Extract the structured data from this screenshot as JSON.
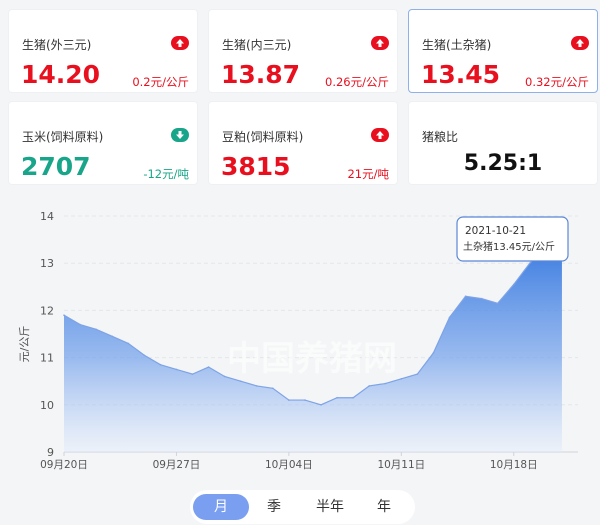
{
  "cards": [
    {
      "name": "生猪(外三元)",
      "value": "14.20",
      "change": "0.2元/公斤",
      "direction": "up"
    },
    {
      "name": "生猪(内三元)",
      "value": "13.87",
      "change": "0.26元/公斤",
      "direction": "up"
    },
    {
      "name": "生猪(土杂猪)",
      "value": "13.45",
      "change": "0.32元/公斤",
      "direction": "up"
    },
    {
      "name": "玉米(饲料原料)",
      "value": "2707",
      "change": "-12元/吨",
      "direction": "down"
    },
    {
      "name": "豆粕(饲料原料)",
      "value": "3815",
      "change": "21元/吨",
      "direction": "up"
    },
    {
      "name": "猪粮比",
      "value": "5.25:1"
    }
  ],
  "colors": {
    "up": "#e8101e",
    "down": "#18a589",
    "line": "#7ea3e6",
    "marker": "#2f7ae0"
  },
  "watermark": "中国养猪网",
  "tooltip": {
    "date": "2021-10-21",
    "text": "土杂猪13.45元/公斤"
  },
  "tabs": [
    "月",
    "季",
    "半年",
    "年"
  ],
  "active_tab": 0,
  "chart_data": {
    "type": "area",
    "ylabel": "元/公斤",
    "ylim": [
      9,
      14
    ],
    "yticks": [
      9,
      10,
      11,
      12,
      13,
      14
    ],
    "start_date": "2021-09-20",
    "xtick_labels": [
      {
        "day": 0,
        "label": "09月20日"
      },
      {
        "day": 7,
        "label": "09月27日"
      },
      {
        "day": 14,
        "label": "10月04日"
      },
      {
        "day": 21,
        "label": "10月11日"
      },
      {
        "day": 28,
        "label": "10月18日"
      }
    ],
    "series": [
      {
        "name": "土杂猪",
        "points": [
          {
            "date": "09-20",
            "day": 0,
            "value": 11.9
          },
          {
            "date": "09-21",
            "day": 1,
            "value": 11.7
          },
          {
            "date": "09-22",
            "day": 2,
            "value": 11.6
          },
          {
            "date": "09-23",
            "day": 3,
            "value": 11.45
          },
          {
            "date": "09-24",
            "day": 4,
            "value": 11.3
          },
          {
            "date": "09-25",
            "day": 5,
            "value": 11.05
          },
          {
            "date": "09-26",
            "day": 6,
            "value": 10.85
          },
          {
            "date": "09-27",
            "day": 7,
            "value": 10.75
          },
          {
            "date": "09-28",
            "day": 8,
            "value": 10.65
          },
          {
            "date": "09-29",
            "day": 9,
            "value": 10.8
          },
          {
            "date": "09-30",
            "day": 10,
            "value": 10.6
          },
          {
            "date": "10-01",
            "day": 11,
            "value": 10.5
          },
          {
            "date": "10-02",
            "day": 12,
            "value": 10.4
          },
          {
            "date": "10-03",
            "day": 13,
            "value": 10.35
          },
          {
            "date": "10-04",
            "day": 14,
            "value": 10.1
          },
          {
            "date": "10-05",
            "day": 15,
            "value": 10.1
          },
          {
            "date": "10-06",
            "day": 16,
            "value": 10.0
          },
          {
            "date": "10-07",
            "day": 17,
            "value": 10.15
          },
          {
            "date": "10-08",
            "day": 18,
            "value": 10.15
          },
          {
            "date": "10-09",
            "day": 19,
            "value": 10.4
          },
          {
            "date": "10-10",
            "day": 20,
            "value": 10.45
          },
          {
            "date": "10-11",
            "day": 21,
            "value": 10.55
          },
          {
            "date": "10-12",
            "day": 22,
            "value": 10.65
          },
          {
            "date": "10-13",
            "day": 23,
            "value": 11.1
          },
          {
            "date": "10-14",
            "day": 24,
            "value": 11.85
          },
          {
            "date": "10-15",
            "day": 25,
            "value": 12.3
          },
          {
            "date": "10-16",
            "day": 26,
            "value": 12.25
          },
          {
            "date": "10-17",
            "day": 27,
            "value": 12.15
          },
          {
            "date": "10-18",
            "day": 28,
            "value": 12.55
          },
          {
            "date": "10-19",
            "day": 29,
            "value": 13.0
          },
          {
            "date": "10-20",
            "day": 30,
            "value": 13.3
          },
          {
            "date": "10-21",
            "day": 31,
            "value": 13.45
          }
        ]
      }
    ]
  }
}
